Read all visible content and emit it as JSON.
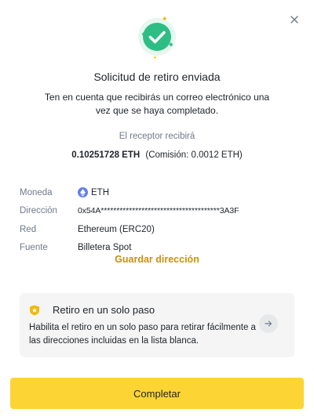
{
  "dialog": {
    "title": "Solicitud de retiro enviada",
    "description": "Ten en cuenta que recibirás un correo electrónico una vez que se haya completado.",
    "close_icon": "close-icon",
    "success_icon": "check-circle-icon"
  },
  "receive": {
    "label": "El receptor recibirá",
    "amount": "0.10251728 ETH",
    "fee": "(Comisión: 0.0012 ETH)"
  },
  "details": {
    "rows": [
      {
        "key": "Moneda",
        "value": "ETH",
        "icon": "eth-icon"
      },
      {
        "key": "Dirección",
        "value": "0x54A**************************************3A3F"
      },
      {
        "key": "Red",
        "value": "Ethereum (ERC20)"
      },
      {
        "key": "Fuente",
        "value": "Billetera Spot"
      }
    ]
  },
  "save_address_label": "Guardar dirección",
  "one_step": {
    "title": "Retiro en un solo paso",
    "description": "Habilita el retiro en un solo paso para retirar fácilmente a las direcciones incluidas en la lista blanca.",
    "icon": "shield-icon",
    "arrow_icon": "arrow-right-icon"
  },
  "complete_label": "Completar",
  "colors": {
    "accent": "#FCD535",
    "link": "#C99400",
    "success": "#2EBD85",
    "eth": "#627EEA"
  }
}
